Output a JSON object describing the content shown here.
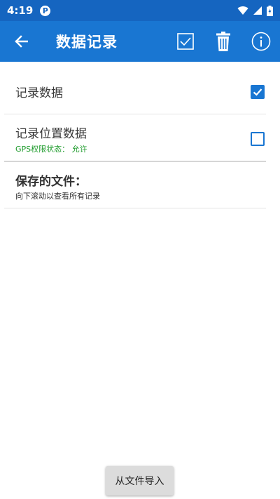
{
  "status_bar": {
    "time": "4:19",
    "notification_badge": "P"
  },
  "app_bar": {
    "back_icon": "arrow-back-icon",
    "title": "数据记录",
    "actions": [
      "select-all-checkbox-icon",
      "trash-icon",
      "info-icon"
    ]
  },
  "settings": {
    "record_data": {
      "label": "记录数据",
      "checked": true
    },
    "record_location": {
      "label": "记录位置数据",
      "gps_status": "GPS权限状态： 允许",
      "checked": false
    }
  },
  "files": {
    "title": "保存的文件：",
    "hint": "向下滚动以查看所有记录"
  },
  "import_button": {
    "label": "从文件导入"
  },
  "colors": {
    "status_bar": "#1565c0",
    "app_bar": "#1976d2",
    "accent": "#1976d2",
    "gps_text": "#1c9a2a"
  }
}
